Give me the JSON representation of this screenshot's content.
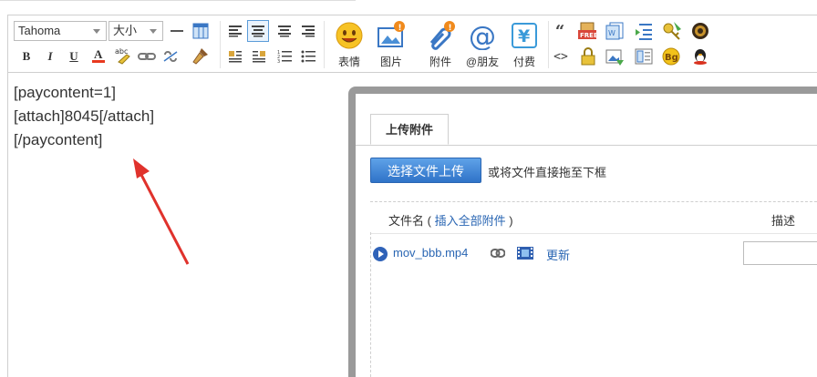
{
  "toolbar": {
    "font_select": "Tahoma",
    "size_select": "大小",
    "big_buttons": [
      {
        "name": "emoticon-button",
        "label": "表情"
      },
      {
        "name": "image-button",
        "label": "图片"
      },
      {
        "name": "attachment-button",
        "label": "附件"
      },
      {
        "name": "mention-friend-button",
        "label": "@朋友"
      },
      {
        "name": "paid-content-button",
        "label": "付费"
      }
    ]
  },
  "editor": {
    "lines": [
      "[paycontent=1]",
      "[attach]8045[/attach]",
      "[/paycontent]"
    ]
  },
  "dialog": {
    "tab_label": "上传附件",
    "upload_button": "选择文件上传",
    "drop_hint": "或将文件直接拖至下框",
    "header_filename": "文件名",
    "header_paren_open": "(",
    "header_insert_all": "插入全部附件",
    "header_paren_close": ")",
    "header_description": "描述",
    "files": [
      {
        "name": "mov_bbb.mp4",
        "update_label": "更新",
        "description": ""
      }
    ]
  },
  "colors": {
    "accent_blue": "#2f73c8",
    "link_blue": "#2a66b3",
    "arrow_red": "#e0322c",
    "dialog_frame": "#9a9a9a"
  }
}
